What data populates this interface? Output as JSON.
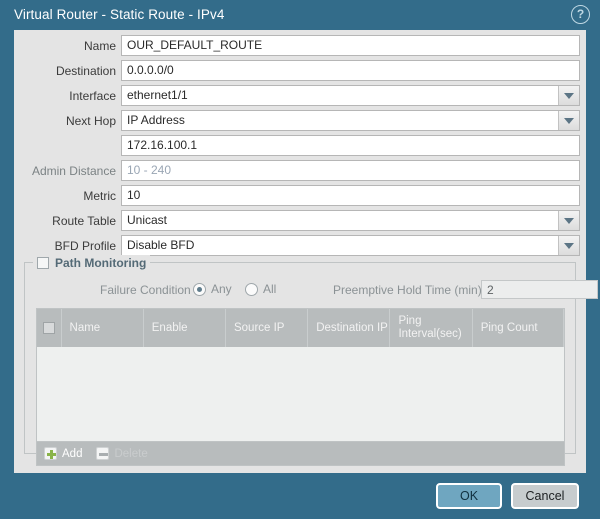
{
  "window": {
    "title": "Virtual Router - Static Route - IPv4",
    "help_icon": "help-circle-icon",
    "help_glyph": "?"
  },
  "form": {
    "fields": [
      {
        "label": "Name",
        "value": "OUR_DEFAULT_ROUTE",
        "type": "text",
        "placeholder": "",
        "dropdown": false,
        "disabled": false,
        "dim_label": false
      },
      {
        "label": "Destination",
        "value": "0.0.0.0/0",
        "type": "text",
        "placeholder": "",
        "dropdown": false,
        "disabled": false,
        "dim_label": false
      },
      {
        "label": "Interface",
        "value": "ethernet1/1",
        "type": "select",
        "placeholder": "",
        "dropdown": true,
        "disabled": false,
        "dim_label": false
      },
      {
        "label": "Next Hop",
        "value": "IP Address",
        "type": "select",
        "placeholder": "",
        "dropdown": true,
        "disabled": false,
        "dim_label": false
      },
      {
        "label": "",
        "value": "172.16.100.1",
        "type": "text",
        "placeholder": "",
        "dropdown": false,
        "disabled": false,
        "dim_label": false
      },
      {
        "label": "Admin Distance",
        "value": "",
        "type": "text",
        "placeholder": "10 - 240",
        "dropdown": false,
        "disabled": false,
        "dim_label": true
      },
      {
        "label": "Metric",
        "value": "10",
        "type": "text",
        "placeholder": "",
        "dropdown": false,
        "disabled": false,
        "dim_label": false
      },
      {
        "label": "Route Table",
        "value": "Unicast",
        "type": "select",
        "placeholder": "",
        "dropdown": true,
        "disabled": false,
        "dim_label": false
      },
      {
        "label": "BFD Profile",
        "value": "Disable BFD",
        "type": "select",
        "placeholder": "",
        "dropdown": true,
        "disabled": false,
        "dim_label": false
      }
    ]
  },
  "path_monitoring": {
    "title": "Path Monitoring",
    "enabled": false,
    "failure_condition_label": "Failure Condition",
    "failure_condition_selected": "Any",
    "options": [
      {
        "label": "Any",
        "selected": true
      },
      {
        "label": "All",
        "selected": false
      }
    ],
    "preemptive_hold_time_label": "Preemptive Hold Time (min)",
    "preemptive_hold_time_value": "2",
    "table": {
      "select_all_checked": false,
      "columns": [
        "Name",
        "Enable",
        "Source IP",
        "Destination IP",
        "Ping Interval(sec)",
        "Ping Count"
      ],
      "rows": []
    },
    "toolbar": {
      "add_label": "Add",
      "add_icon": "plus-icon",
      "delete_label": "Delete",
      "delete_icon": "minus-icon",
      "delete_disabled": true
    }
  },
  "footer": {
    "ok_label": "OK",
    "cancel_label": "Cancel"
  },
  "colors": {
    "chrome": "#336c8a",
    "panel": "#e4e4e4",
    "table_header": "#b8bcbd",
    "table_body": "#eef0ef",
    "ok_button": "#6fa6c0",
    "cancel_button": "#c7ccce",
    "add_icon_green": "#8ab44a",
    "radio_dot": "#5f7c8c"
  }
}
